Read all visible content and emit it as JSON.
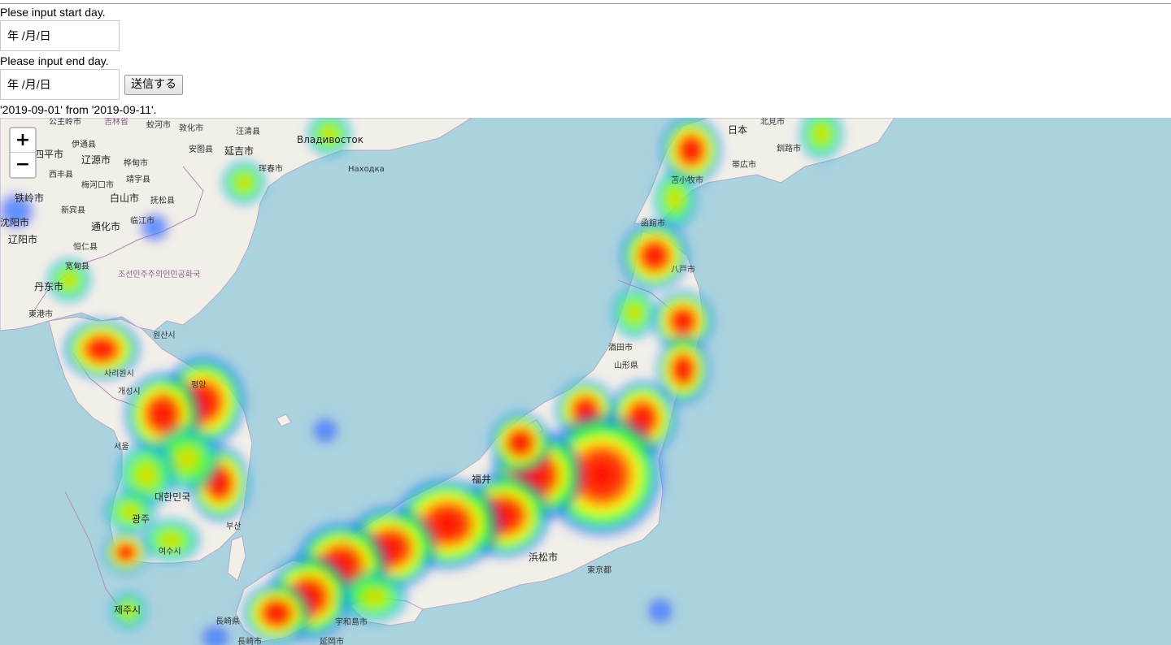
{
  "form": {
    "start_label": "Plese input start day.",
    "start_input_value": "年 /月/日",
    "end_label": "Please input end day.",
    "end_input_value": "年 /月/日",
    "submit_label": "送信する",
    "result_text": "'2019-09-01' from '2019-09-11'."
  },
  "map": {
    "zoom_in_label": "+",
    "zoom_out_label": "−",
    "water_color": "#aad3df",
    "land_color": "#f2efe9",
    "labels": [
      "公主岭市",
      "吉林省",
      "蛟河市",
      "敦化市",
      "汪清县",
      "Владивосток",
      "北見市",
      "日本",
      "伊通县",
      "四平市",
      "辽源市",
      "安图县",
      "延吉市",
      "珲春市",
      "Находка",
      "釧路市",
      "帯広市",
      "西丰县",
      "桦甸市",
      "梅河口市",
      "靖宇县",
      "铁岭市",
      "白山市",
      "抚松县",
      "新宾县",
      "临江市",
      "沈阳市",
      "通化市",
      "辽阳市",
      "恒仁县",
      "宽甸县",
      "丹东市",
      "조선민주주의인민공화국",
      "東港市",
      "원산시",
      "사리원시",
      "개성시",
      "평양",
      "서울",
      "대한민국",
      "광주",
      "여수시",
      "부산",
      "제주시",
      "長崎県",
      "長崎市",
      "宇和島市",
      "延岡市",
      "浜松市",
      "東京都",
      "福井",
      "酒田市",
      "山形県",
      "函館市",
      "八戸市",
      "苫小牧市"
    ]
  },
  "chart_data": {
    "type": "heatmap",
    "title": "",
    "notes": "Heatmap of activity over Japan and Korea; red = highest density, blue = lowest",
    "colors": [
      "#0000ff",
      "#00ffff",
      "#00ff00",
      "#ffff00",
      "#ff0000"
    ]
  }
}
